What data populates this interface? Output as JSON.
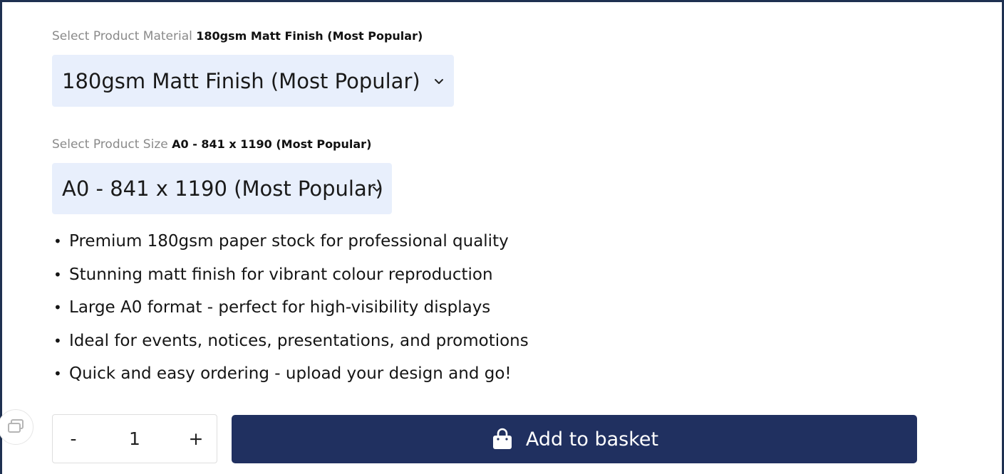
{
  "material": {
    "label_prefix": "Select Product Material",
    "label_value": "180gsm Matt Finish (Most Popular)",
    "selected": "180gsm Matt Finish (Most Popular)"
  },
  "size": {
    "label_prefix": "Select Product Size",
    "label_value": "A0 - 841 x 1190 (Most Popular)",
    "selected": "A0 - 841 x 1190 (Most Popular)"
  },
  "features": [
    "Premium 180gsm paper stock for professional quality",
    "Stunning matt finish for vibrant colour reproduction",
    "Large A0 format - perfect for high-visibility displays",
    "Ideal for events, notices, presentations, and promotions",
    "Quick and easy ordering - upload your design and go!"
  ],
  "quantity": {
    "minus_label": "-",
    "value": "1",
    "plus_label": "+"
  },
  "basket_button": {
    "label": "Add to basket",
    "icon": "shopping-bag-icon"
  },
  "side_tab_icon": "gallery-icon",
  "colors": {
    "frame": "#1e3050",
    "select_bg": "#e8effc",
    "button_bg": "#203060",
    "label_muted": "#8a8a8a"
  }
}
